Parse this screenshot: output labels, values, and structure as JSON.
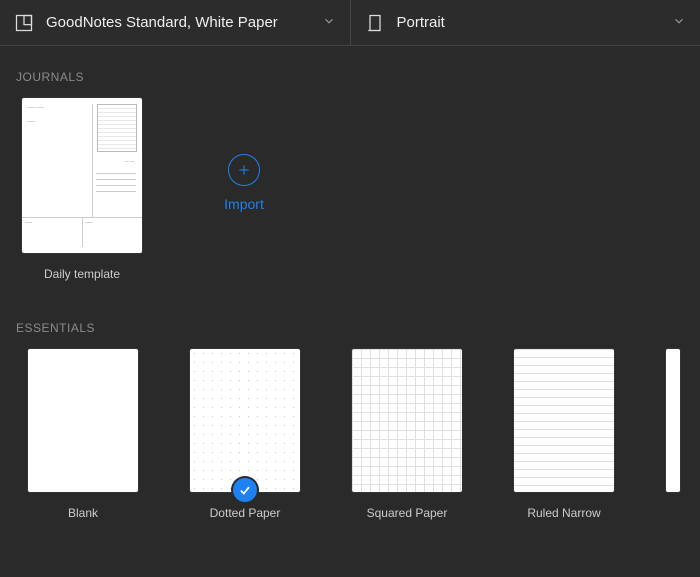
{
  "header": {
    "paper_label": "GoodNotes Standard, White Paper",
    "orientation_label": "Portrait"
  },
  "sections": {
    "journals_label": "JOURNALS",
    "essentials_label": "ESSENTIALS"
  },
  "import_label": "Import",
  "journals": {
    "items": [
      {
        "label": "Daily template"
      }
    ]
  },
  "essentials": {
    "items": [
      {
        "label": "Blank"
      },
      {
        "label": "Dotted Paper",
        "selected": true
      },
      {
        "label": "Squared Paper"
      },
      {
        "label": "Ruled Narrow"
      }
    ]
  },
  "colors": {
    "accent": "#1e81f0"
  },
  "icons": {
    "template": "template-icon",
    "orientation": "orientation-icon",
    "chevron": "chevron-down-icon",
    "plus": "plus-icon",
    "check": "check-icon"
  }
}
